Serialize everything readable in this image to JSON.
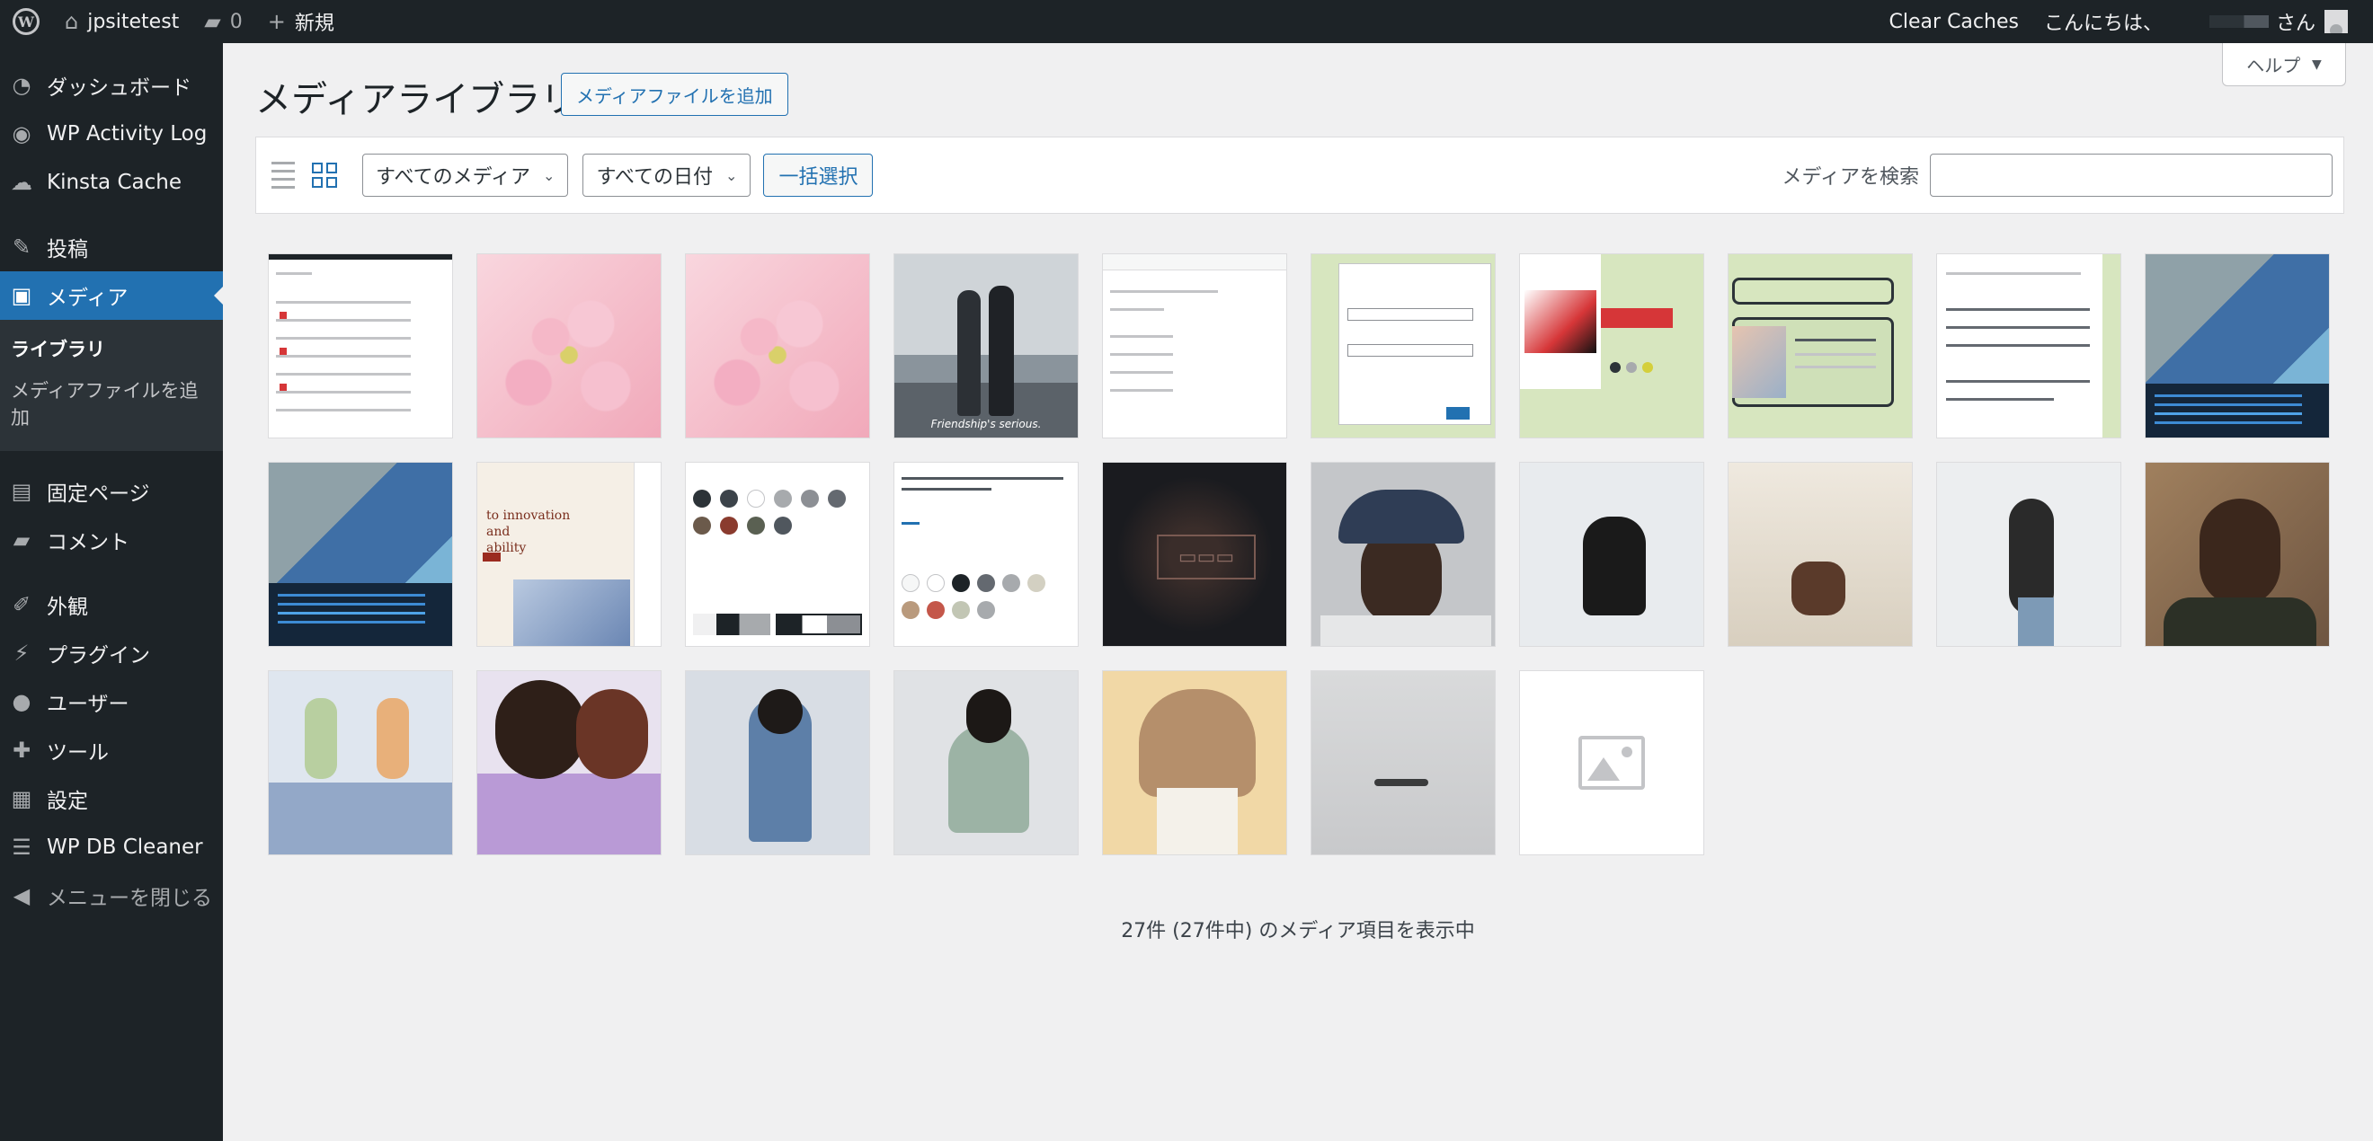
{
  "adminbar": {
    "site_name": "jpsitetest",
    "comments_count": "0",
    "new_label": "新規",
    "clear_caches": "Clear Caches",
    "greeting": "こんにちは、",
    "san": "さん"
  },
  "sidebar": {
    "items": [
      {
        "label": "ダッシュボード",
        "icon": "dashboard-icon"
      },
      {
        "label": "WP Activity Log",
        "icon": "activity-log-icon"
      },
      {
        "label": "Kinsta Cache",
        "icon": "cloud-icon"
      },
      {
        "label": "投稿",
        "icon": "pin-icon"
      },
      {
        "label": "メディア",
        "icon": "media-icon"
      },
      {
        "label": "固定ページ",
        "icon": "page-icon"
      },
      {
        "label": "コメント",
        "icon": "comment-icon"
      },
      {
        "label": "外観",
        "icon": "brush-icon"
      },
      {
        "label": "プラグイン",
        "icon": "plugin-icon"
      },
      {
        "label": "ユーザー",
        "icon": "user-icon"
      },
      {
        "label": "ツール",
        "icon": "wrench-icon"
      },
      {
        "label": "設定",
        "icon": "settings-icon"
      },
      {
        "label": "WP DB Cleaner",
        "icon": "database-icon"
      },
      {
        "label": "メニューを閉じる",
        "icon": "collapse-icon"
      }
    ],
    "submenu": {
      "library": "ライブラリ",
      "add_new": "メディアファイルを追加"
    }
  },
  "help_tab": "ヘルプ",
  "page": {
    "title": "メディアライブラリ",
    "add_new": "メディアファイルを追加"
  },
  "toolbar": {
    "filter_media": "すべてのメディア",
    "filter_date": "すべての日付",
    "bulk_select": "一括選択",
    "search_label": "メディアを検索",
    "search_value": ""
  },
  "thumbnails": {
    "caption_friendship": "Friendship's serious."
  },
  "footer_count": "27件 (27件中) のメディア項目を表示中",
  "colors": {
    "accent": "#2271b1",
    "adminbar": "#1d2327",
    "background": "#f0f0f1"
  }
}
